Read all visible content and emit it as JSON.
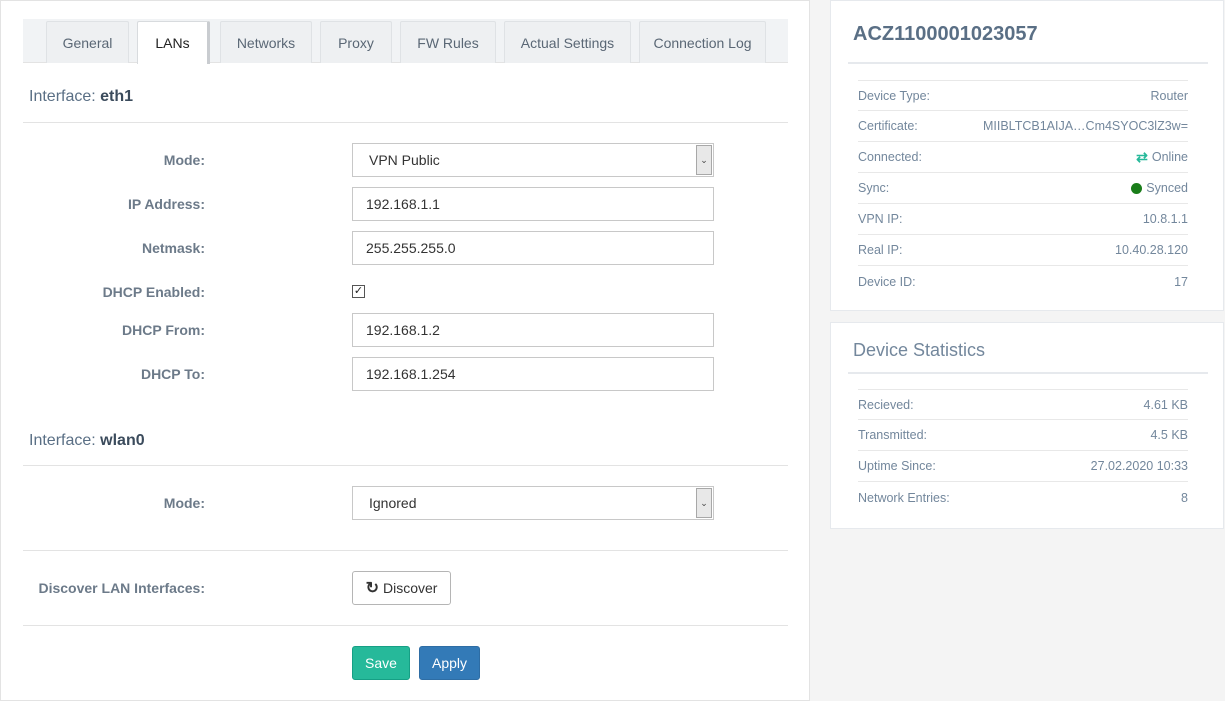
{
  "tabs": [
    {
      "label": "General"
    },
    {
      "label": "LANs"
    },
    {
      "label": "Networks"
    },
    {
      "label": "Proxy"
    },
    {
      "label": "FW Rules"
    },
    {
      "label": "Actual Settings"
    },
    {
      "label": "Connection Log"
    }
  ],
  "active_tab": "LANs",
  "eth1": {
    "prefix": "Interface: ",
    "name": "eth1",
    "mode_label": "Mode:",
    "mode_value": "VPN Public",
    "ip_label": "IP Address:",
    "ip_value": "192.168.1.1",
    "netmask_label": "Netmask:",
    "netmask_value": "255.255.255.0",
    "dhcp_enabled_label": "DHCP Enabled:",
    "dhcp_enabled": true,
    "dhcp_from_label": "DHCP From:",
    "dhcp_from_value": "192.168.1.2",
    "dhcp_to_label": "DHCP To:",
    "dhcp_to_value": "192.168.1.254"
  },
  "wlan0": {
    "prefix": "Interface: ",
    "name": "wlan0",
    "mode_label": "Mode:",
    "mode_value": "Ignored"
  },
  "discover": {
    "label": "Discover LAN Interfaces:",
    "button": "Discover"
  },
  "actions": {
    "save": "Save",
    "apply": "Apply"
  },
  "device": {
    "title": "ACZ1100001023057",
    "rows": [
      {
        "key": "Device Type:",
        "value": "Router"
      },
      {
        "key": "Certificate:",
        "value": "MIIBLTCB1AIJA…Cm4SYOC3lZ3w="
      },
      {
        "key": "Connected:",
        "value": "Online"
      },
      {
        "key": "Sync:",
        "value": "Synced"
      },
      {
        "key": "VPN IP:",
        "value": "10.8.1.1"
      },
      {
        "key": "Real IP:",
        "value": "10.40.28.120"
      },
      {
        "key": "Device ID:",
        "value": "17"
      }
    ]
  },
  "stats": {
    "title": "Device Statistics",
    "rows": [
      {
        "key": "Recieved:",
        "value": "4.61 KB"
      },
      {
        "key": "Transmitted:",
        "value": "4.5 KB"
      },
      {
        "key": "Uptime Since:",
        "value": "27.02.2020 10:33"
      },
      {
        "key": "Network Entries:",
        "value": "8"
      }
    ]
  },
  "colors": {
    "online": "#26b99a",
    "synced": "#1a7d1a",
    "save": "#26b99a",
    "apply": "#337ab7"
  }
}
